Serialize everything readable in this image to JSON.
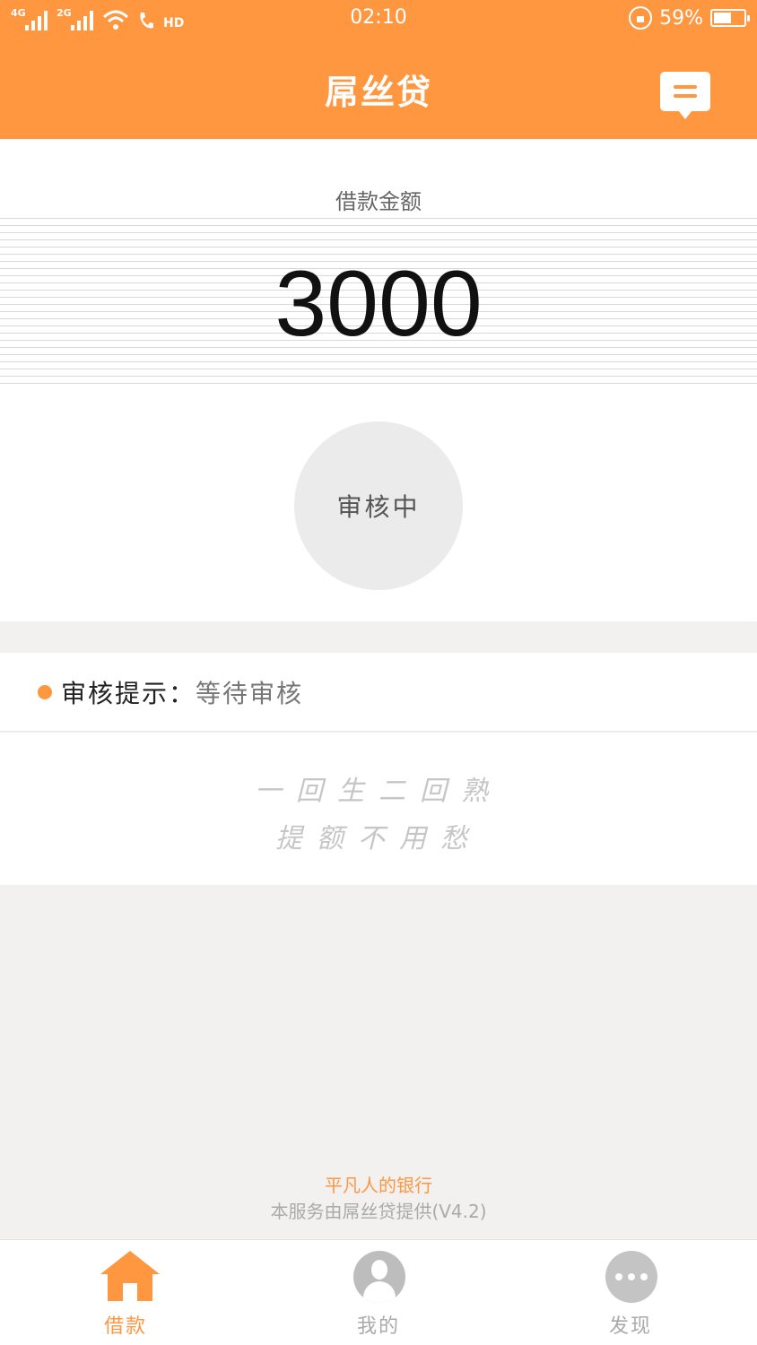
{
  "status_bar": {
    "net1": "4G",
    "net2": "2G",
    "hd": "HD",
    "time": "02:10",
    "battery": "59%",
    "battery_level": 0.59
  },
  "header": {
    "title": "屌丝贷"
  },
  "loan": {
    "amount_label": "借款金额",
    "amount": "3000",
    "status": "审核中"
  },
  "review": {
    "label": "审核提示：",
    "value": "等待审核"
  },
  "slogan": {
    "line1": "一回生二回熟",
    "line2": "提额不用愁"
  },
  "footer": {
    "tagline": "平凡人的银行",
    "provider": "本服务由屌丝贷提供(V4.2)"
  },
  "nav": {
    "items": [
      {
        "label": "借款",
        "icon": "home-icon",
        "active": true
      },
      {
        "label": "我的",
        "icon": "avatar-icon",
        "active": false
      },
      {
        "label": "发现",
        "icon": "more-icon",
        "active": false
      }
    ]
  },
  "colors": {
    "accent": "#ff9640",
    "page_bg": "#f2f1f0",
    "muted": "#aaaaaa"
  }
}
